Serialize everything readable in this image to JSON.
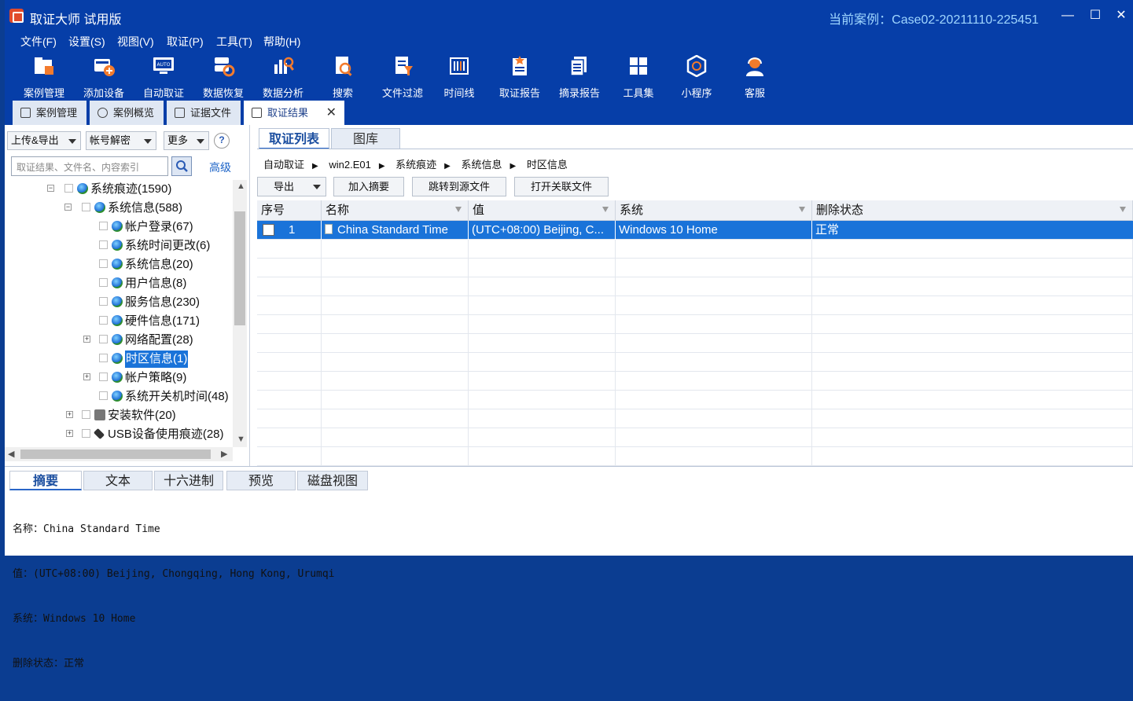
{
  "window": {
    "title": "取证大师 试用版",
    "case_label": "当前案例：Case02-20211110-225451",
    "controls": [
      "—",
      "☐",
      "✕"
    ]
  },
  "menu": [
    "文件(F)",
    "设置(S)",
    "视图(V)",
    "取证(P)",
    "工具(T)",
    "帮助(H)"
  ],
  "toolbar": [
    {
      "label": "案例管理",
      "icon": "case-folder-icon"
    },
    {
      "label": "添加设备",
      "icon": "add-device-icon"
    },
    {
      "label": "自动取证",
      "icon": "auto-forensics-icon"
    },
    {
      "label": "数据恢复",
      "icon": "data-recovery-icon"
    },
    {
      "label": "数据分析",
      "icon": "data-analysis-icon"
    },
    {
      "label": "搜索",
      "icon": "search-doc-icon"
    },
    {
      "label": "文件过滤",
      "icon": "file-filter-icon"
    },
    {
      "label": "时间线",
      "icon": "timeline-icon"
    },
    {
      "label": "取证报告",
      "icon": "report-icon"
    },
    {
      "label": "摘录报告",
      "icon": "excerpt-report-icon"
    },
    {
      "label": "工具集",
      "icon": "toolset-icon"
    },
    {
      "label": "小程序",
      "icon": "mini-program-icon"
    },
    {
      "label": "客服",
      "icon": "support-icon"
    }
  ],
  "doc_tabs": [
    {
      "label": "案例管理",
      "active": false
    },
    {
      "label": "案例概览",
      "active": false
    },
    {
      "label": "证据文件",
      "active": false
    },
    {
      "label": "取证结果",
      "active": true,
      "close": "✕"
    }
  ],
  "left": {
    "btn_upload": "上传&导出",
    "btn_decrypt": "帐号解密",
    "btn_more": "更多",
    "help": "?",
    "search_placeholder": "取证结果、文件名、内容索引",
    "advanced": "高级",
    "tree": [
      {
        "label": "系统痕迹(1590)",
        "level": 0,
        "expander": "−"
      },
      {
        "label": "系统信息(588)",
        "level": 1,
        "expander": "−"
      },
      {
        "label": "帐户登录(67)",
        "level": 2
      },
      {
        "label": "系统时间更改(6)",
        "level": 2
      },
      {
        "label": "系统信息(20)",
        "level": 2
      },
      {
        "label": "用户信息(8)",
        "level": 2
      },
      {
        "label": "服务信息(230)",
        "level": 2
      },
      {
        "label": "硬件信息(171)",
        "level": 2
      },
      {
        "label": "网络配置(28)",
        "level": 2,
        "expander": "+"
      },
      {
        "label": "时区信息(1)",
        "level": 2,
        "selected": true
      },
      {
        "label": "帐户策略(9)",
        "level": 2,
        "expander": "+"
      },
      {
        "label": "系统开关机时间(48)",
        "level": 2
      },
      {
        "label": "安装软件(20)",
        "level": 1,
        "expander": "+"
      },
      {
        "label": "USB设备使用痕迹(28)",
        "level": 1,
        "expander": "+"
      }
    ]
  },
  "right": {
    "tabs": [
      {
        "label": "取证列表",
        "active": true
      },
      {
        "label": "图库",
        "active": false
      }
    ],
    "breadcrumb": [
      "自动取证",
      "win2.E01",
      "系统痕迹",
      "系统信息",
      "时区信息"
    ],
    "crumb_sep": "▶",
    "actions": {
      "export": "导出",
      "add_summary": "加入摘要",
      "jump_source": "跳转到源文件",
      "open_related": "打开关联文件"
    },
    "columns": [
      "序号",
      "名称",
      "值",
      "系统",
      "删除状态"
    ],
    "rows": [
      {
        "index": "1",
        "name": "China Standard Time",
        "value": "(UTC+08:00) Beijing, C...",
        "system": "Windows 10 Home",
        "status": "正常",
        "selected": true
      }
    ]
  },
  "bottom": {
    "tabs": [
      "摘要",
      "文本",
      "十六进制",
      "预览",
      "磁盘视图"
    ],
    "summary_lines": [
      "名称：China Standard Time",
      "值：(UTC+08:00) Beijing, Chongqing, Hong Kong, Urumqi",
      "系统：Windows 10 Home",
      "删除状态：正常"
    ]
  },
  "colors": {
    "titlebar": "#063ea8",
    "selection": "#1a73d9",
    "case_text": "#9fd6ff"
  }
}
